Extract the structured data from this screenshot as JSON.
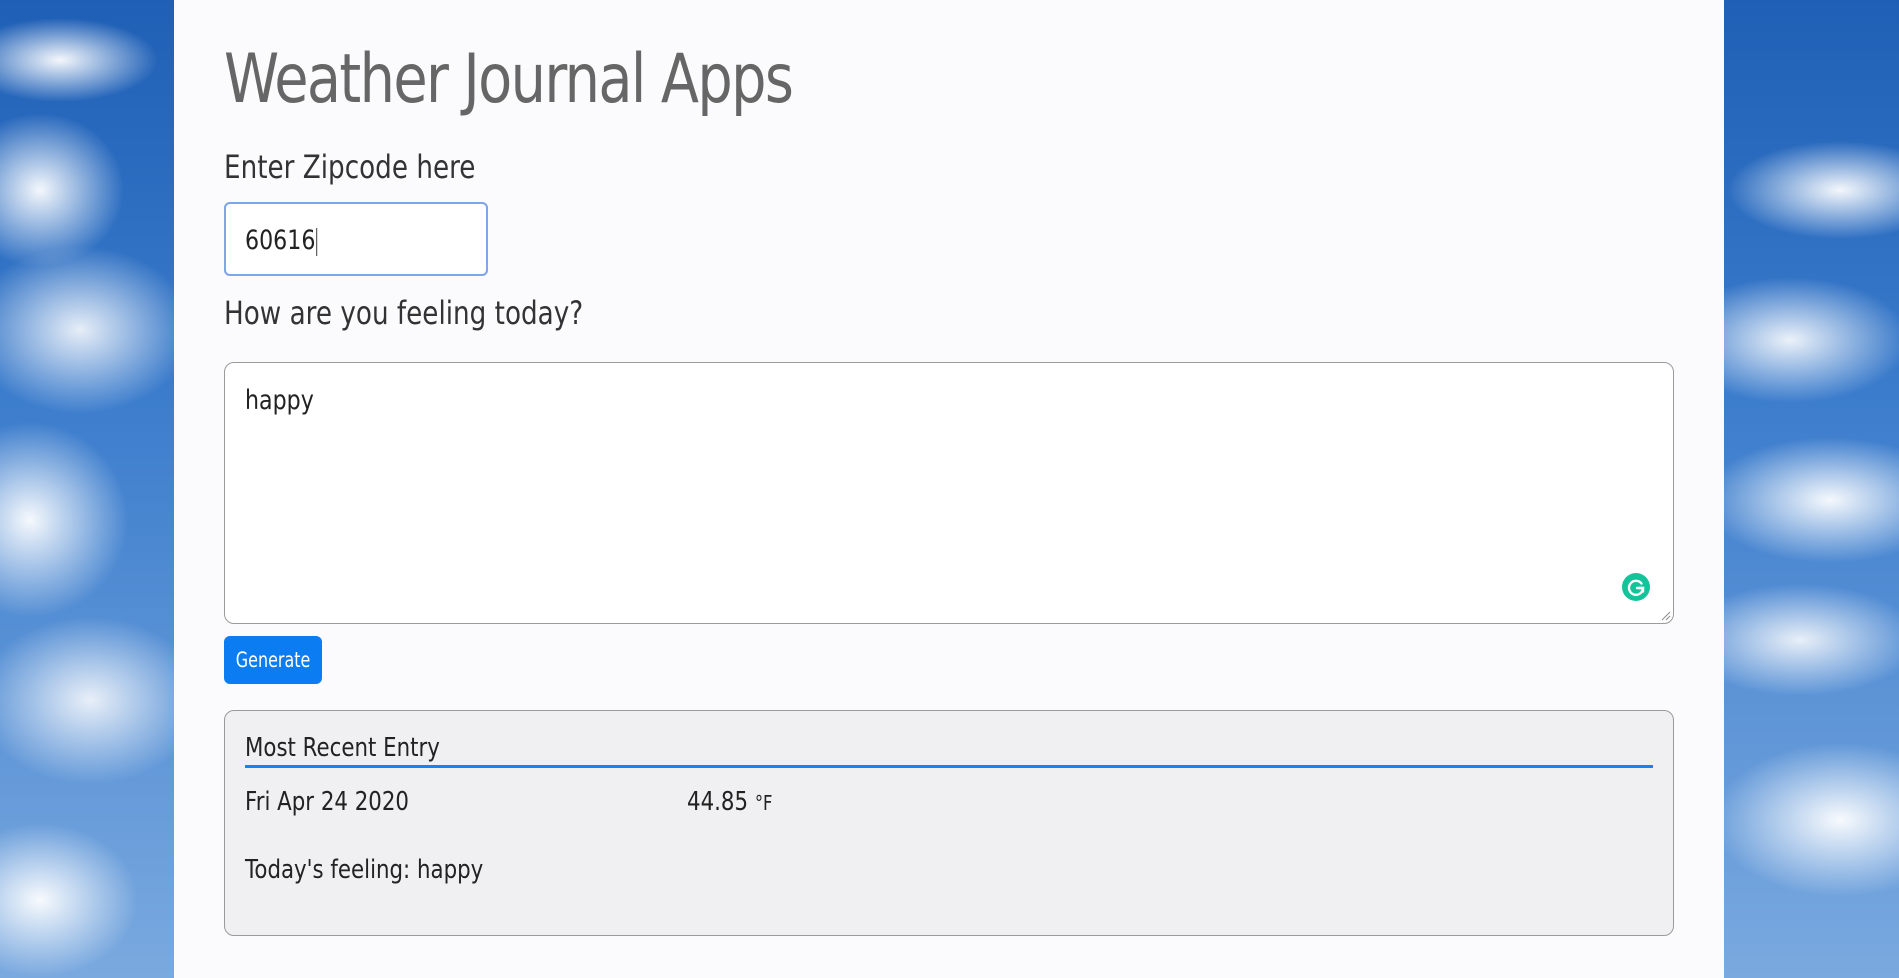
{
  "page": {
    "title": "Weather Journal Apps"
  },
  "form": {
    "zip_label": "Enter Zipcode here",
    "zip_value": "60616",
    "feelings_label": "How are you feeling today?",
    "feelings_value": "happy",
    "generate_label": "Generate"
  },
  "entry": {
    "heading": "Most Recent Entry",
    "date": "Fri Apr 24 2020",
    "temp": "44.85",
    "temp_unit": "°F",
    "content": "Today's feeling: happy"
  },
  "colors": {
    "accent": "#0b7cf2",
    "grammarly": "#15c39a"
  }
}
